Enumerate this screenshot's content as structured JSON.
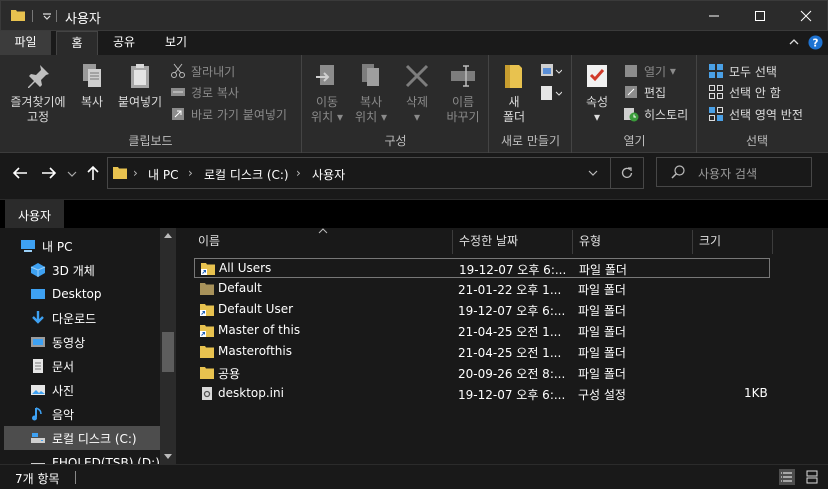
{
  "window": {
    "title": "사용자"
  },
  "tabs": {
    "file": "파일",
    "home": "홈",
    "share": "공유",
    "view": "보기"
  },
  "ribbon": {
    "clipboard": {
      "label": "클립보드",
      "pin": [
        "즐겨찾기에",
        "고정"
      ],
      "copy": "복사",
      "paste": "붙여넣기",
      "cut": "잘라내기",
      "copy_path": "경로 복사",
      "paste_shortcut": "바로 가기 붙여넣기"
    },
    "organize": {
      "label": "구성",
      "move_to": [
        "이동",
        "위치"
      ],
      "copy_to": [
        "복사",
        "위치"
      ],
      "delete": "삭제",
      "rename": [
        "이름",
        "바꾸기"
      ]
    },
    "new": {
      "label": "새로 만들기",
      "new_folder": [
        "새",
        "폴더"
      ]
    },
    "open": {
      "label": "열기",
      "properties": "속성",
      "open": "열기",
      "edit": "편집",
      "history": "히스토리"
    },
    "select": {
      "label": "선택",
      "select_all": "모두 선택",
      "select_none": "선택 안 함",
      "invert": "선택 영역 반전"
    }
  },
  "address": {
    "segments": [
      "내 PC",
      "로컬 디스크 (C:)",
      "사용자"
    ]
  },
  "search": {
    "placeholder": "사용자 검색"
  },
  "strip_tab": "사용자",
  "nav_pane": {
    "items": [
      {
        "label": "내 PC",
        "icon": "pc-icon"
      },
      {
        "label": "3D 개체",
        "icon": "cube-icon"
      },
      {
        "label": "Desktop",
        "icon": "desktop-icon"
      },
      {
        "label": "다운로드",
        "icon": "download-icon"
      },
      {
        "label": "동영상",
        "icon": "video-icon"
      },
      {
        "label": "문서",
        "icon": "document-icon"
      },
      {
        "label": "사진",
        "icon": "picture-icon"
      },
      {
        "label": "음악",
        "icon": "music-icon"
      },
      {
        "label": "로컬 디스크 (C:)",
        "icon": "drive-icon"
      },
      {
        "label": "FHOLED(TSB) (D:)",
        "icon": "drive-icon"
      }
    ]
  },
  "file_list": {
    "columns": [
      "이름",
      "수정한 날짜",
      "유형",
      "크기"
    ],
    "rows": [
      {
        "name": "All Users",
        "date": "19-12-07 오후 6:...",
        "type": "파일 폴더",
        "size": ""
      },
      {
        "name": "Default",
        "date": "21-01-22 오후 1...",
        "type": "파일 폴더",
        "size": ""
      },
      {
        "name": "Default User",
        "date": "19-12-07 오후 6:...",
        "type": "파일 폴더",
        "size": ""
      },
      {
        "name": "Master of this",
        "date": "21-04-25 오전 1...",
        "type": "파일 폴더",
        "size": ""
      },
      {
        "name": "Masterofthis",
        "date": "21-04-25 오전 1...",
        "type": "파일 폴더",
        "size": ""
      },
      {
        "name": "공용",
        "date": "20-09-26 오전 8:...",
        "type": "파일 폴더",
        "size": ""
      },
      {
        "name": "desktop.ini",
        "date": "19-12-07 오후 6:...",
        "type": "구성 설정",
        "size": "1KB"
      }
    ]
  },
  "status": {
    "count": "7개 항목"
  },
  "colors": {
    "folder": "#dcb44a",
    "accent": "#0078d7",
    "background": "#191919"
  }
}
